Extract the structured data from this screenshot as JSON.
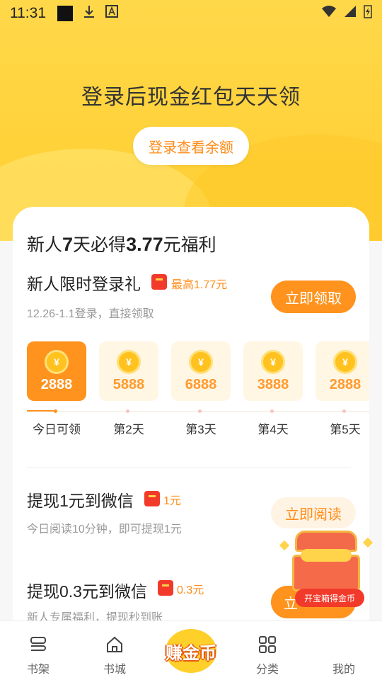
{
  "status_bar": {
    "time": "11:31"
  },
  "hero": {
    "title": "登录后现金红包天天领",
    "login_button": "登录查看余额"
  },
  "card": {
    "title_part1": "新人",
    "title_bold1": "7",
    "title_part2": "天必得",
    "title_bold2": "3.77",
    "title_part3": "元福利"
  },
  "login_gift": {
    "title": "新人限时登录礼",
    "reward": "最高1.77元",
    "subtitle": "12.26-1.1登录，直接领取",
    "button": "立即领取",
    "days": [
      {
        "amount": "2888",
        "label": "今日可领",
        "active": true
      },
      {
        "amount": "5888",
        "label": "第2天",
        "active": false
      },
      {
        "amount": "6888",
        "label": "第3天",
        "active": false
      },
      {
        "amount": "3888",
        "label": "第4天",
        "active": false
      },
      {
        "amount": "2888",
        "label": "第5天",
        "active": false
      }
    ]
  },
  "withdraw1": {
    "title": "提现1元到微信",
    "reward": "1元",
    "subtitle": "今日阅读10分钟，即可提现1元",
    "button": "立即阅读"
  },
  "withdraw2": {
    "title": "提现0.3元到微信",
    "reward": "0.3元",
    "subtitle": "新人专属福利，提现秒到账",
    "button": "立"
  },
  "treasure": {
    "label": "开宝箱得金币"
  },
  "tabbar": {
    "bookshelf": "书架",
    "bookstore": "书城",
    "earn": "赚金币",
    "category": "分类",
    "mine": "我的"
  },
  "colors": {
    "accent": "#ff931e",
    "hero_yellow": "#ffd23a",
    "red": "#f23a2a"
  }
}
